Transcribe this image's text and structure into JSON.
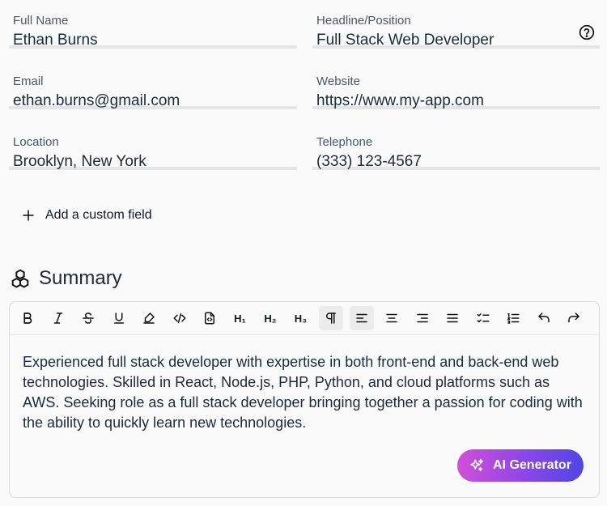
{
  "fields": {
    "full_name": {
      "label": "Full Name",
      "value": "Ethan Burns"
    },
    "headline": {
      "label": "Headline/Position",
      "value": "Full Stack Web Developer"
    },
    "email": {
      "label": "Email",
      "value": "ethan.burns@gmail.com"
    },
    "website": {
      "label": "Website",
      "value": "https://www.my-app.com"
    },
    "location": {
      "label": "Location",
      "value": "Brooklyn, New York"
    },
    "telephone": {
      "label": "Telephone",
      "value": "(333) 123-4567"
    }
  },
  "add_field_label": "Add a custom field",
  "summary": {
    "title": "Summary",
    "text": "Experienced full stack developer with expertise in both front-end and back-end web technologies. Skilled in React, Node.js, PHP, Python, and cloud platforms such as AWS. Seeking role as a full stack developer bringing together a passion for coding with the ability to quickly learn new technologies.",
    "ai_button": "AI Generator"
  },
  "toolbar": {
    "h1": "H₁",
    "h2": "H₂",
    "h3": "H₃"
  },
  "icons": [
    "help-icon",
    "plus-icon",
    "cubes-icon",
    "bold-icon",
    "italic-icon",
    "strikethrough-icon",
    "underline-icon",
    "highlight-icon",
    "code-icon",
    "code-block-icon",
    "paragraph-icon",
    "align-left-icon",
    "align-center-icon",
    "align-right-icon",
    "align-justify-icon",
    "checklist-icon",
    "ordered-list-icon",
    "undo-icon",
    "redo-icon",
    "sparkles-icon"
  ],
  "colors": {
    "ai_gradient_start": "#d14fd6",
    "ai_gradient_end": "#4f46e5",
    "field_border": "#e5e5e5"
  }
}
